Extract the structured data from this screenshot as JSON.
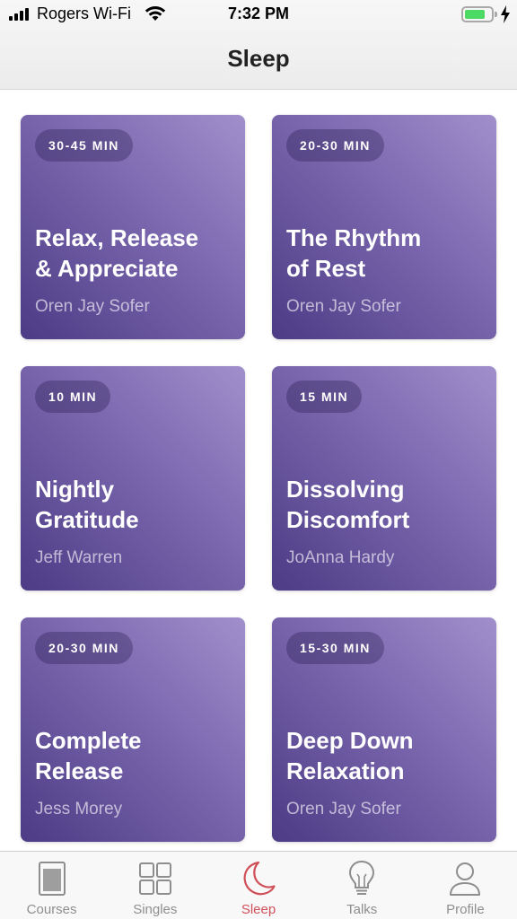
{
  "status_bar": {
    "carrier": "Rogers Wi-Fi",
    "time": "7:32 PM"
  },
  "nav": {
    "title": "Sleep"
  },
  "cards": [
    {
      "duration": "30-45 MIN",
      "title_line1": "Relax, Release",
      "title_line2": "& Appreciate",
      "author": "Oren Jay Sofer"
    },
    {
      "duration": "20-30 MIN",
      "title_line1": "The Rhythm",
      "title_line2": "of Rest",
      "author": "Oren Jay Sofer"
    },
    {
      "duration": "10 MIN",
      "title_line1": "Nightly",
      "title_line2": "Gratitude",
      "author": "Jeff Warren"
    },
    {
      "duration": "15 MIN",
      "title_line1": "Dissolving",
      "title_line2": "Discomfort",
      "author": "JoAnna Hardy"
    },
    {
      "duration": "20-30 MIN",
      "title_line1": "Complete",
      "title_line2": "Release",
      "author": "Jess Morey"
    },
    {
      "duration": "15-30 MIN",
      "title_line1": "Deep Down",
      "title_line2": "Relaxation",
      "author": "Oren Jay Sofer"
    }
  ],
  "tabs": [
    {
      "label": "Courses",
      "icon": "book-icon"
    },
    {
      "label": "Singles",
      "icon": "grid-icon"
    },
    {
      "label": "Sleep",
      "icon": "moon-icon",
      "active": true
    },
    {
      "label": "Talks",
      "icon": "lightbulb-icon"
    },
    {
      "label": "Profile",
      "icon": "person-icon"
    }
  ],
  "colors": {
    "accent": "#d0505a",
    "card_gradient_light": "#a18fcc",
    "card_gradient_dark": "#4c3b85",
    "tab_inactive": "#8e8e8e"
  }
}
